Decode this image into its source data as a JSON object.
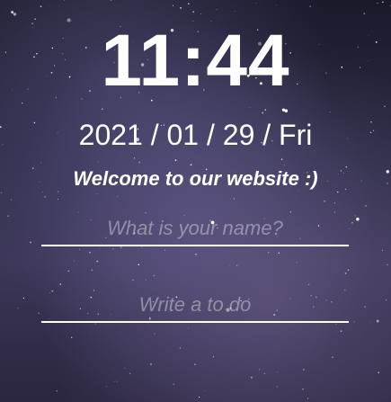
{
  "clock": {
    "time": "11:44"
  },
  "date": {
    "text": "2021 / 01 / 29 / Fri"
  },
  "greeting": {
    "text": "Welcome to our website :)"
  },
  "name_input": {
    "placeholder": "What is your name?",
    "value": ""
  },
  "todo_input": {
    "placeholder": "Write a to do",
    "value": ""
  },
  "colors": {
    "text": "#ffffff",
    "underline": "#ffffff",
    "sky": "#2a2a44"
  }
}
